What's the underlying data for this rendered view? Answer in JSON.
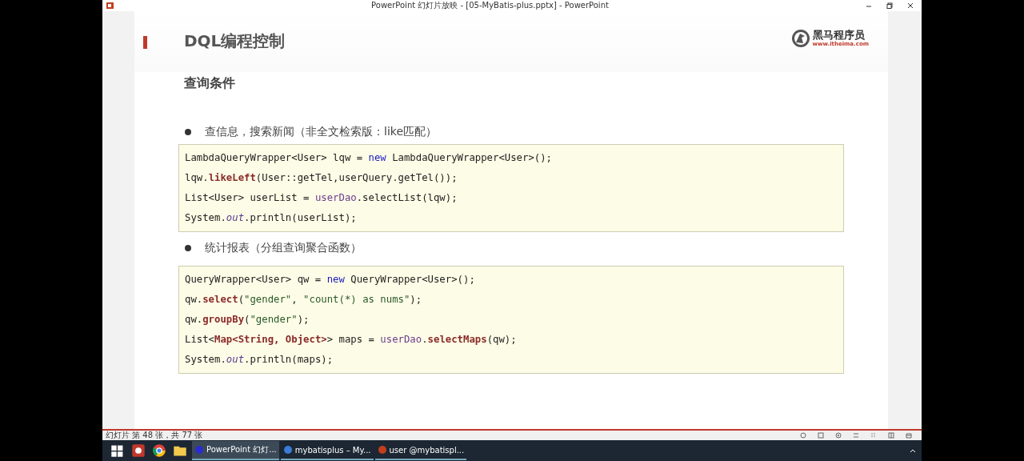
{
  "window": {
    "title": "PowerPoint 幻灯片放映 - [05-MyBatis-plus.pptx] - PowerPoint"
  },
  "slide": {
    "title": "DQL编程控制",
    "logo": {
      "name": "黑马程序员",
      "url": "www.itheima.com"
    },
    "subtitle": "查询条件",
    "sections": [
      {
        "bullet": "查信息，搜索新闻（非全文检索版：like匹配）",
        "code": [
          [
            {
              "kind": "plain",
              "text": "LambdaQueryWrapper<User> lqw = "
            },
            {
              "kind": "keyword",
              "text": "new"
            },
            {
              "kind": "plain",
              "text": " LambdaQueryWrapper<User>();"
            }
          ],
          [
            {
              "kind": "plain",
              "text": "lqw."
            },
            {
              "kind": "method",
              "text": "likeLeft"
            },
            {
              "kind": "plain",
              "text": "(User::getTel,userQuery.getTel());"
            }
          ],
          [
            {
              "kind": "plain",
              "text": "List<User> userList = "
            },
            {
              "kind": "field",
              "text": "userDao"
            },
            {
              "kind": "plain",
              "text": ".selectList(lqw);"
            }
          ],
          [
            {
              "kind": "plain",
              "text": "System."
            },
            {
              "kind": "static",
              "text": "out"
            },
            {
              "kind": "plain",
              "text": ".println(userList);"
            }
          ]
        ]
      },
      {
        "bullet": "统计报表（分组查询聚合函数）",
        "code": [
          [
            {
              "kind": "plain",
              "text": "QueryWrapper<User> qw = "
            },
            {
              "kind": "keyword",
              "text": "new"
            },
            {
              "kind": "plain",
              "text": " QueryWrapper<User>();"
            }
          ],
          [
            {
              "kind": "plain",
              "text": "qw."
            },
            {
              "kind": "method",
              "text": "select"
            },
            {
              "kind": "plain",
              "text": "("
            },
            {
              "kind": "string",
              "text": "\"gender\""
            },
            {
              "kind": "plain",
              "text": ", "
            },
            {
              "kind": "string",
              "text": "\"count(*) as nums\""
            },
            {
              "kind": "plain",
              "text": ");"
            }
          ],
          [
            {
              "kind": "plain",
              "text": "qw."
            },
            {
              "kind": "method",
              "text": "groupBy"
            },
            {
              "kind": "plain",
              "text": "("
            },
            {
              "kind": "string",
              "text": "\"gender\""
            },
            {
              "kind": "plain",
              "text": ");"
            }
          ],
          [
            {
              "kind": "plain",
              "text": "List<"
            },
            {
              "kind": "method",
              "text": "Map<String, Object>"
            },
            {
              "kind": "plain",
              "text": "> maps = "
            },
            {
              "kind": "field",
              "text": "userDao"
            },
            {
              "kind": "plain",
              "text": "."
            },
            {
              "kind": "method",
              "text": "selectMaps"
            },
            {
              "kind": "plain",
              "text": "(qw);"
            }
          ],
          [
            {
              "kind": "plain",
              "text": "System."
            },
            {
              "kind": "static",
              "text": "out"
            },
            {
              "kind": "plain",
              "text": ".println(maps);"
            }
          ]
        ]
      }
    ]
  },
  "status_bar": {
    "slide_counter": "幻灯片 第 48 张，共 77 张"
  },
  "taskbar": {
    "items": [
      {
        "kind": "start"
      },
      {
        "kind": "app"
      },
      {
        "kind": "browser"
      },
      {
        "kind": "folder"
      },
      {
        "kind": "window",
        "label": "PowerPoint 幻灯...",
        "selected": true
      },
      {
        "kind": "window",
        "label": "mybatisplus – My...",
        "selected": false
      },
      {
        "kind": "window",
        "label": "user @mybatispl...",
        "selected": false
      }
    ]
  }
}
